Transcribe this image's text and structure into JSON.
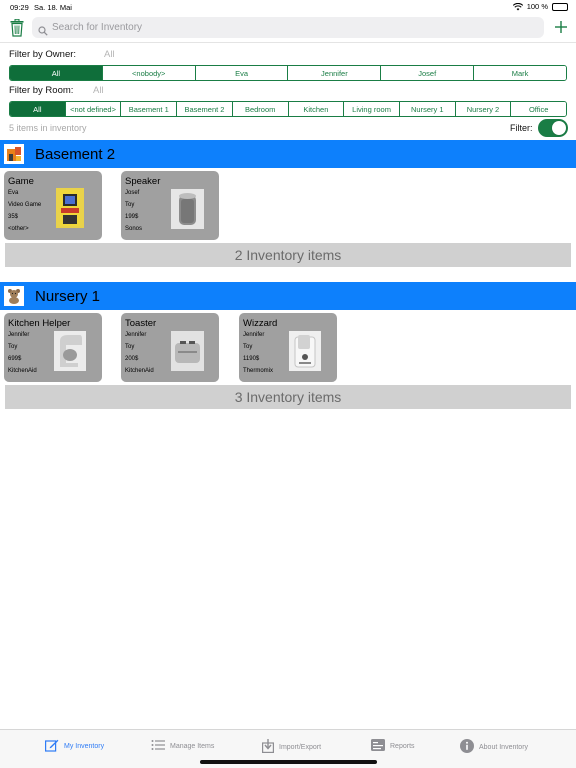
{
  "status_bar": {
    "time": "09:29",
    "date": "Sa. 18. Mai",
    "battery": "100 %"
  },
  "search": {
    "placeholder": "Search for Inventory"
  },
  "filter_owner": {
    "label": "Filter by Owner:",
    "value": "All",
    "segments": [
      "All",
      "<nobody>",
      "Eva",
      "Jennifer",
      "Josef",
      "Mark"
    ],
    "selected": 0
  },
  "filter_room": {
    "label": "Filter by Room:",
    "value": "All",
    "segments": [
      "All",
      "<not defined>",
      "Basement 1",
      "Basement 2",
      "Bedroom",
      "Kitchen",
      "Living room",
      "Nursery 1",
      "Nursery 2",
      "Office"
    ],
    "selected": 0
  },
  "items_count": "5 items in inventory",
  "filter_toggle": {
    "label": "Filter:",
    "on": true
  },
  "sections": [
    {
      "title": "Basement 2",
      "icon": "basement-icon",
      "summary": "2 Inventory items",
      "items": [
        {
          "name": "Game",
          "owner": "Eva",
          "category": "Video Game",
          "price": "35$",
          "brand": "<other>",
          "image": "arcade-machine-image"
        },
        {
          "name": "Speaker",
          "owner": "Josef",
          "category": "Toy",
          "price": "199$",
          "brand": "Sonos",
          "image": "speaker-image"
        }
      ]
    },
    {
      "title": "Nursery 1",
      "icon": "teddy-bear-icon",
      "summary": "3 Inventory items",
      "items": [
        {
          "name": "Kitchen Helper",
          "owner": "Jennifer",
          "category": "Toy",
          "price": "699$",
          "brand": "KitchenAid",
          "image": "kitchen-mixer-image"
        },
        {
          "name": "Toaster",
          "owner": "Jennifer",
          "category": "Toy",
          "price": "200$",
          "brand": "KitchenAid",
          "image": "toaster-image"
        },
        {
          "name": "Wizzard",
          "owner": "Jennifer",
          "category": "Toy",
          "price": "1190$",
          "brand": "Thermomix",
          "image": "thermomix-image"
        }
      ]
    }
  ],
  "tabs": [
    {
      "label": "My Inventory",
      "icon": "edit-square-icon",
      "active": true
    },
    {
      "label": "Manage Items",
      "icon": "list-icon",
      "active": false
    },
    {
      "label": "Import/Export",
      "icon": "import-export-icon",
      "active": false
    },
    {
      "label": "Reports",
      "icon": "reports-icon",
      "active": false
    },
    {
      "label": "About Inventory",
      "icon": "info-icon",
      "active": false
    }
  ],
  "colors": {
    "accent_green": "#1a7d45",
    "section_blue": "#0d80fc",
    "tab_active": "#2f7cf6",
    "card_gray": "#a0a0a0"
  }
}
